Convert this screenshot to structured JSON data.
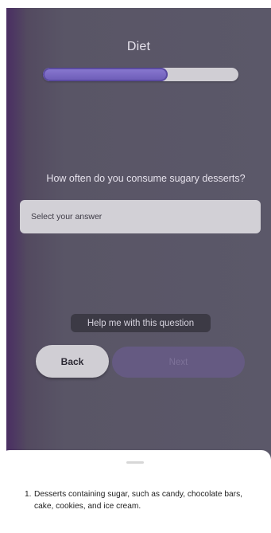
{
  "header": {
    "title": "Diet"
  },
  "progress": {
    "value": 0.64
  },
  "question": {
    "text": "How often do you consume sugary desserts?"
  },
  "answer_select": {
    "placeholder": "Select your answer"
  },
  "help": {
    "label": "Help me with this question"
  },
  "nav": {
    "back_label": "Back",
    "next_label": "Next"
  },
  "footnote": {
    "number": "1.",
    "text": "Desserts containing sugar, such as candy, chocolate bars, cake, cookies, and ice cream."
  },
  "colors": {
    "accent": "#6b5bb6",
    "background": "#5b5869"
  }
}
